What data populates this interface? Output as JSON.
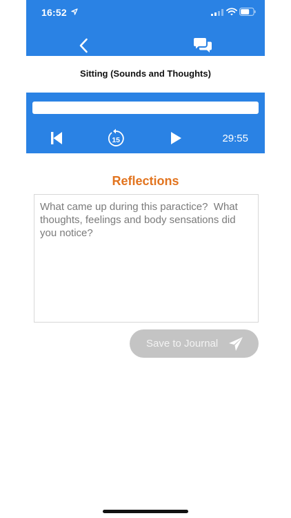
{
  "status_bar": {
    "time": "16:52",
    "icons": [
      "location-arrow-icon",
      "signal-icon",
      "wifi-icon",
      "battery-icon"
    ]
  },
  "nav": {
    "back_icon": "chevron-left-icon",
    "chat_icon": "chat-bubbles-icon"
  },
  "session": {
    "title": "Sitting (Sounds and Thoughts)"
  },
  "player": {
    "progress": 0,
    "time_remaining": "29:55",
    "rewind_seconds": "15",
    "controls": [
      "skip-back-icon",
      "rewind-15-icon",
      "play-icon"
    ]
  },
  "reflections": {
    "heading": "Reflections",
    "placeholder": "What came up during this paractice?  What thoughts, feelings and body sensations did you notice?",
    "value": ""
  },
  "actions": {
    "save_label": "Save to Journal",
    "save_icon": "paper-plane-icon"
  },
  "colors": {
    "primary": "#2a82e4",
    "accent": "#e2741f",
    "disabled_button": "#c4c4c4"
  }
}
